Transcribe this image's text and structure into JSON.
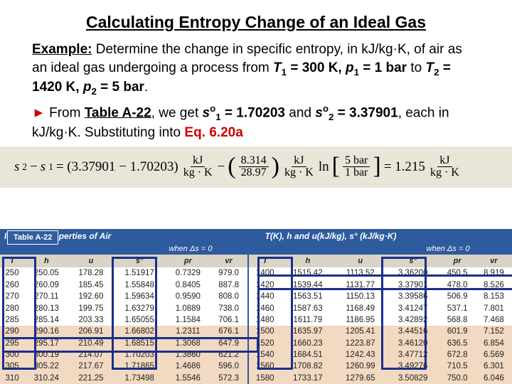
{
  "title": "Calculating Entropy Change of an Ideal Gas",
  "example_label": "Example:",
  "example_line1": "  Determine the change in specific entropy, in kJ/kg·K, of air as an ideal gas undergoing a process from ",
  "cond1": "T",
  "cond1_sub": "1",
  "cond1_rest": " = 300 K, ",
  "cond2": "p",
  "cond2_sub": "1",
  "cond2_rest": " = 1 bar",
  "to_word": " to ",
  "cond3": "T",
  "cond3_sub": "2",
  "cond3_rest": " = 1420 K, ",
  "cond4": "p",
  "cond4_sub": "2",
  "cond4_rest": " = 5 bar",
  "period": ".",
  "arrow": "►",
  "from_text": " From ",
  "table_ref": "Table A-22",
  "we_get": ", we get ",
  "so1_var": "s",
  "so1_sup": "o",
  "so1_sub": "1",
  "so1_val": " = 1.70203",
  "and_word": " and ",
  "so2_var": "s",
  "so2_sup": "o",
  "so2_sub": "2",
  "so2_val": " = 3.37901",
  "each_in": ", each in kJ/kg·K.  Substituting into ",
  "eq_ref": "Eq. 6.20a",
  "equation": {
    "lhs_s2": "s",
    "lhs_s2sub": "2",
    "minus": " − ",
    "lhs_s1": "s",
    "lhs_s1sub": "1",
    "eq": " = (3.37901 − 1.70203)",
    "unit_num": "kJ",
    "unit_den": "kg · K",
    "minus2": " − ",
    "r_num": "8.314",
    "r_den": "28.97",
    "ln": "ln",
    "ln_num": "5 bar",
    "ln_den": "1 bar",
    "eq2": " = 1.215",
    "unit2_num": "kJ",
    "unit2_den": "kg · K"
  },
  "table": {
    "label": "Table A-22",
    "caption_left": "Ideal Gas Properties of Air",
    "caption_mid_a": "T(K), h and u(kJ/kg), s° (kJ/kg·K)",
    "caption_mid_b": "when Δs = 0",
    "caption_mid_b2": "when Δs = 0",
    "headers": [
      "T",
      "h",
      "u",
      "s°",
      "pr",
      "vr",
      "T",
      "h",
      "u",
      "s°",
      "pr",
      "vr"
    ],
    "rows": [
      {
        "band": false,
        "c": [
          "250",
          "250.05",
          "178.28",
          "1.51917",
          "0.7329",
          "979.0",
          "1400",
          "1515.42",
          "1113.52",
          "3.36200",
          "450.5",
          "8.919"
        ]
      },
      {
        "band": false,
        "c": [
          "260",
          "260.09",
          "185.45",
          "1.55848",
          "0.8405",
          "887.8",
          "1420",
          "1539.44",
          "1131.77",
          "3.37901",
          "478.0",
          "8.526"
        ]
      },
      {
        "band": false,
        "c": [
          "270",
          "270.11",
          "192.60",
          "1.59634",
          "0.9590",
          "808.0",
          "1440",
          "1563.51",
          "1150.13",
          "3.39586",
          "506.9",
          "8.153"
        ]
      },
      {
        "band": false,
        "c": [
          "280",
          "280.13",
          "199.75",
          "1.63279",
          "1.0889",
          "738.0",
          "1460",
          "1587.63",
          "1168.49",
          "3.41247",
          "537.1",
          "7.801"
        ]
      },
      {
        "band": false,
        "c": [
          "285",
          "285.14",
          "203.33",
          "1.65055",
          "1.1584",
          "706.1",
          "1480",
          "1611.79",
          "1186.95",
          "3.42892",
          "568.8",
          "7.468"
        ]
      },
      {
        "band": true,
        "c": [
          "290",
          "290.16",
          "206.91",
          "1.66802",
          "1.2311",
          "676.1",
          "1500",
          "1635.97",
          "1205.41",
          "3.44516",
          "601.9",
          "7.152"
        ]
      },
      {
        "band": true,
        "c": [
          "295",
          "295.17",
          "210.49",
          "1.68515",
          "1.3068",
          "647.9",
          "1520",
          "1660.23",
          "1223.87",
          "3.46120",
          "636.5",
          "6.854"
        ]
      },
      {
        "band": true,
        "c": [
          "300",
          "300.19",
          "214.07",
          "1.70203",
          "1.3860",
          "621.2",
          "1540",
          "1684.51",
          "1242.43",
          "3.47712",
          "672.8",
          "6.569"
        ]
      },
      {
        "band": true,
        "c": [
          "305",
          "305.22",
          "217.67",
          "1.71865",
          "1.4686",
          "596.0",
          "1560",
          "1708.82",
          "1260.99",
          "3.49276",
          "710.5",
          "6.301"
        ]
      },
      {
        "band": true,
        "c": [
          "310",
          "310.24",
          "221.25",
          "1.73498",
          "1.5546",
          "572.3",
          "1580",
          "1733.17",
          "1279.65",
          "3.50829",
          "750.0",
          "6.046"
        ]
      }
    ]
  }
}
